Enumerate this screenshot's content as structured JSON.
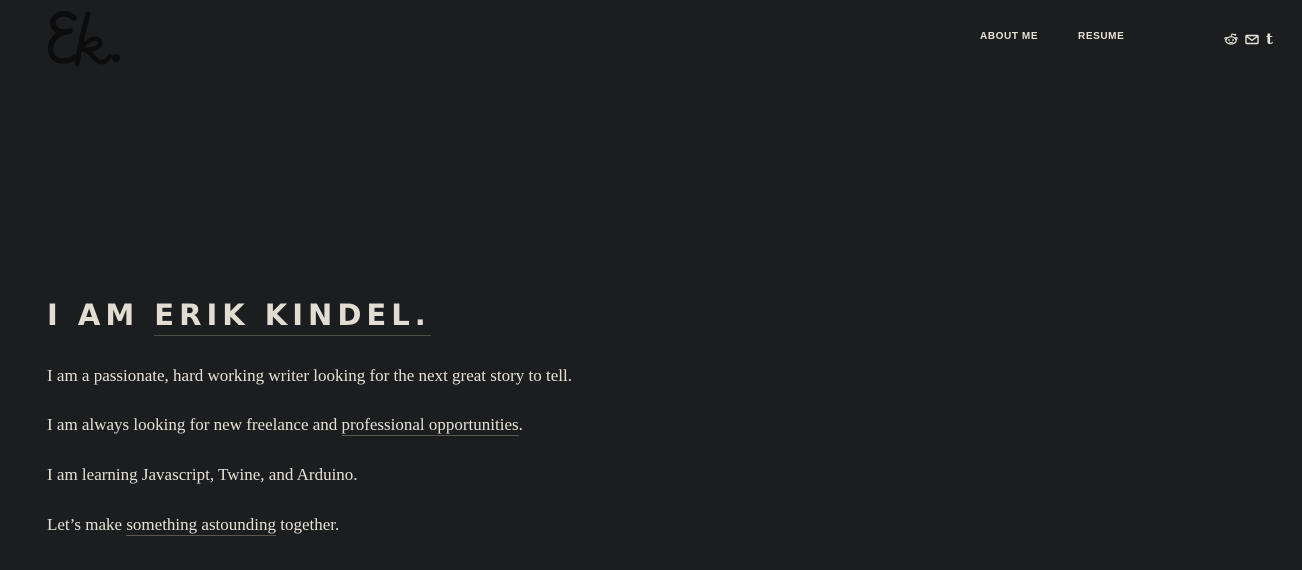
{
  "header": {
    "logo": {
      "text": "Ek."
    },
    "nav": [
      {
        "label": "ABOUT ME"
      },
      {
        "label": "RESUME"
      }
    ],
    "social": [
      {
        "icon": "reddit-icon"
      },
      {
        "icon": "mail-icon"
      },
      {
        "icon": "tumblr-icon",
        "glyph": "t"
      }
    ]
  },
  "hero": {
    "headline_prefix": "I AM ",
    "headline_name": "ERIK KINDEL.",
    "lines": [
      {
        "text": "I am a passionate, hard working writer looking for the next great story to tell."
      },
      {
        "before": "I am always looking for new freelance and ",
        "link": "professional opportunities",
        "after": "."
      },
      {
        "text": "I am learning Javascript, Twine, and Arduino."
      },
      {
        "before": "Let’s make ",
        "link": "something astounding",
        "after": " together."
      }
    ]
  },
  "colors": {
    "background": "#1c1d1f",
    "text": "#e2ddd3",
    "logo": "#0c0c0c"
  }
}
